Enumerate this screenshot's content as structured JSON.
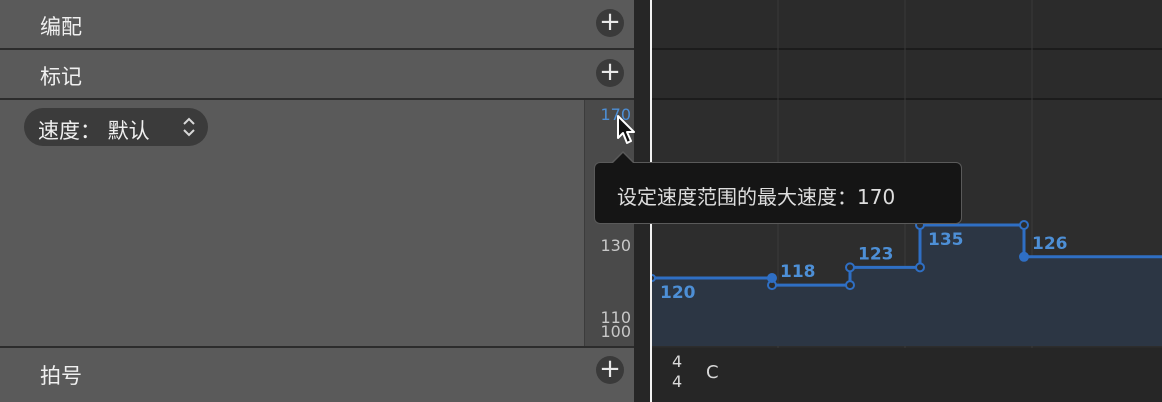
{
  "tracks": {
    "arrangement_label": "编配",
    "markers_label": "标记",
    "signature_label": "拍号"
  },
  "tempo": {
    "selector_label": "速度：  默认",
    "scale_top": "170",
    "scale_labels": [
      "130",
      "110",
      "100"
    ]
  },
  "tooltip": {
    "text": "设定速度范围的最大速度：170"
  },
  "tempo_events": [
    {
      "label": "120",
      "value": 120
    },
    {
      "label": "118",
      "value": 118
    },
    {
      "label": "123",
      "value": 123
    },
    {
      "label": "135",
      "value": 135
    },
    {
      "label": "126",
      "value": 126
    }
  ],
  "signature": {
    "numerator": "4",
    "denominator": "4",
    "key": "C"
  },
  "colors": {
    "tempo_line": "#2f6fc4",
    "tempo_label": "#4d8fd6",
    "tempo_fill": "#2c3644"
  }
}
